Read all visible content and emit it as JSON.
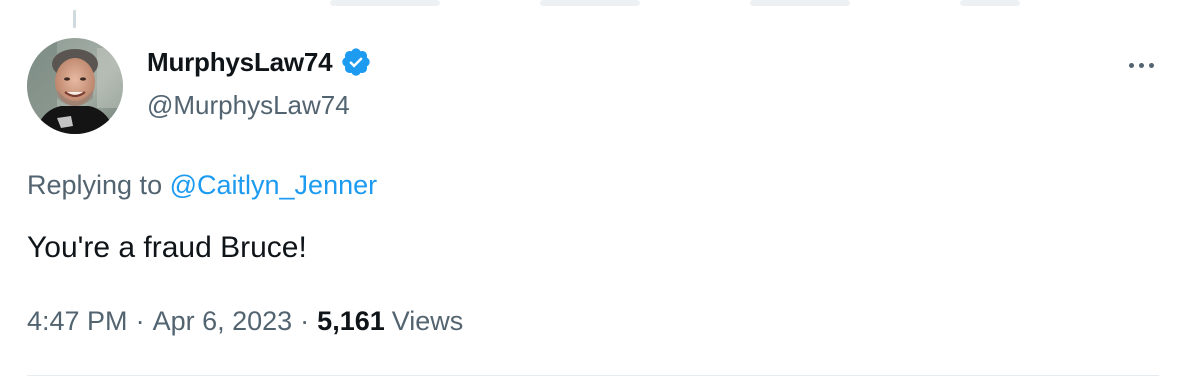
{
  "tweet": {
    "display_name": "MurphysLaw74",
    "handle": "@MurphysLaw74",
    "verified_icon": "verified-badge-icon",
    "replying_prefix": "Replying to ",
    "replying_to": "@Caitlyn_Jenner",
    "text": "You're a fraud Bruce!",
    "time": "4:47 PM",
    "separator": "·",
    "date": "Apr 6, 2023",
    "views_count": "5,161",
    "views_label": "Views",
    "more_icon": "more-options-icon"
  },
  "colors": {
    "text_primary": "#0f1419",
    "text_secondary": "#536471",
    "link": "#1d9bf0",
    "verified": "#1d9bf0",
    "divider": "#e6ecf0"
  }
}
